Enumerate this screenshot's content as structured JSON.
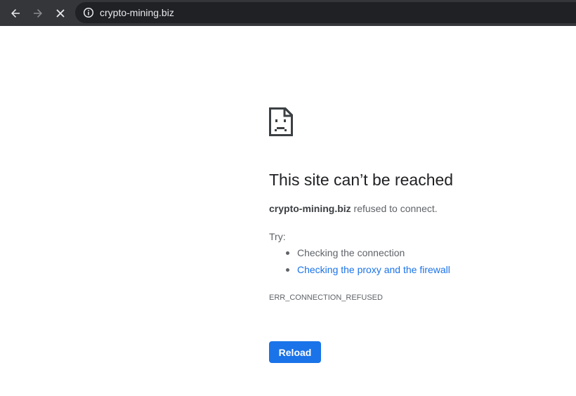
{
  "browser": {
    "url": "crypto-mining.biz",
    "icons": {
      "back": "back-arrow-icon",
      "forward": "forward-arrow-icon",
      "stop": "close-icon",
      "site_info": "info-icon"
    },
    "colors": {
      "toolbar": "#35363a",
      "omnibox": "#202124",
      "url_text": "#e8eaed"
    }
  },
  "error_page": {
    "icon": "sad-page-icon",
    "title": "This site can’t be reached",
    "host": "crypto-mining.biz",
    "summary_rest": " refused to connect.",
    "try_label": "Try:",
    "suggestions": [
      "Checking the connection",
      "Checking the proxy and the firewall"
    ],
    "error_code": "ERR_CONNECTION_REFUSED",
    "reload_label": "Reload",
    "colors": {
      "title": "#202124",
      "body_text": "#5f6368",
      "link": "#1a73e8",
      "button": "#1a73e8"
    }
  }
}
